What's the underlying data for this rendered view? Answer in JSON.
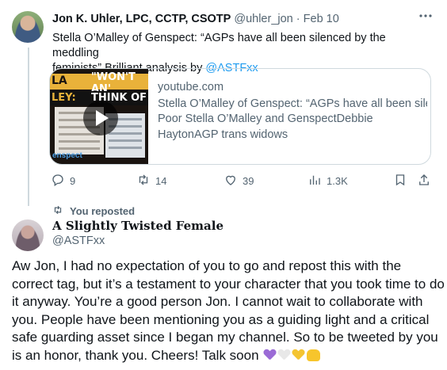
{
  "tweet1": {
    "author_name": "Jon K. Uhler, LPC, CCTP, CSOTP",
    "handle": "@uhler_jon",
    "separator": "·",
    "date": "Feb 10",
    "text_line1": "Stella O’Malley of Genspect: “AGPs have all been silenced by the meddling",
    "text_line2_prefix": "feminists” Brilliant analysis by ",
    "mention": "@ASTFxx",
    "card": {
      "thumb_text_a": "LA",
      "thumb_text_b": "\"WON'T AN'",
      "thumb_text_c": "LEY:",
      "thumb_text_d": "THINK OF THE A",
      "thumb_brand": "enspect",
      "domain": "youtube.com",
      "title": "Stella O’Malley of Genspect: “AGPs have all been silenced by the meddling feminists”",
      "desc_line1": "Poor Stella O’Malley and GenspectDebbie",
      "desc_line2": "HaytonAGP trans widows"
    },
    "actions": {
      "replies": "9",
      "reposts": "14",
      "likes": "39",
      "views": "1.3K"
    }
  },
  "repost_label": "You reposted",
  "tweet2": {
    "author_name": "A Slightly Twisted Female",
    "handle": "@ASTFxx",
    "text": "Aw Jon, I had no expectation of you to go and repost this with the correct tag, but it’s a testament to your character that you took time to do it anyway. You’re a good person Jon. I cannot wait to collaborate with you. People have been mentioning you as a guiding light and a critical safe guarding asset since I began my channel. So to be tweeted by you is an honor, thank you. Cheers! Talk soon",
    "emojis": [
      "purple-heart",
      "white-heart",
      "yellow-heart",
      "raising-hands"
    ]
  },
  "colors": {
    "text": "#0f1419",
    "secondary": "#536471",
    "link": "#1d9bf0",
    "border": "#cfd9de"
  }
}
